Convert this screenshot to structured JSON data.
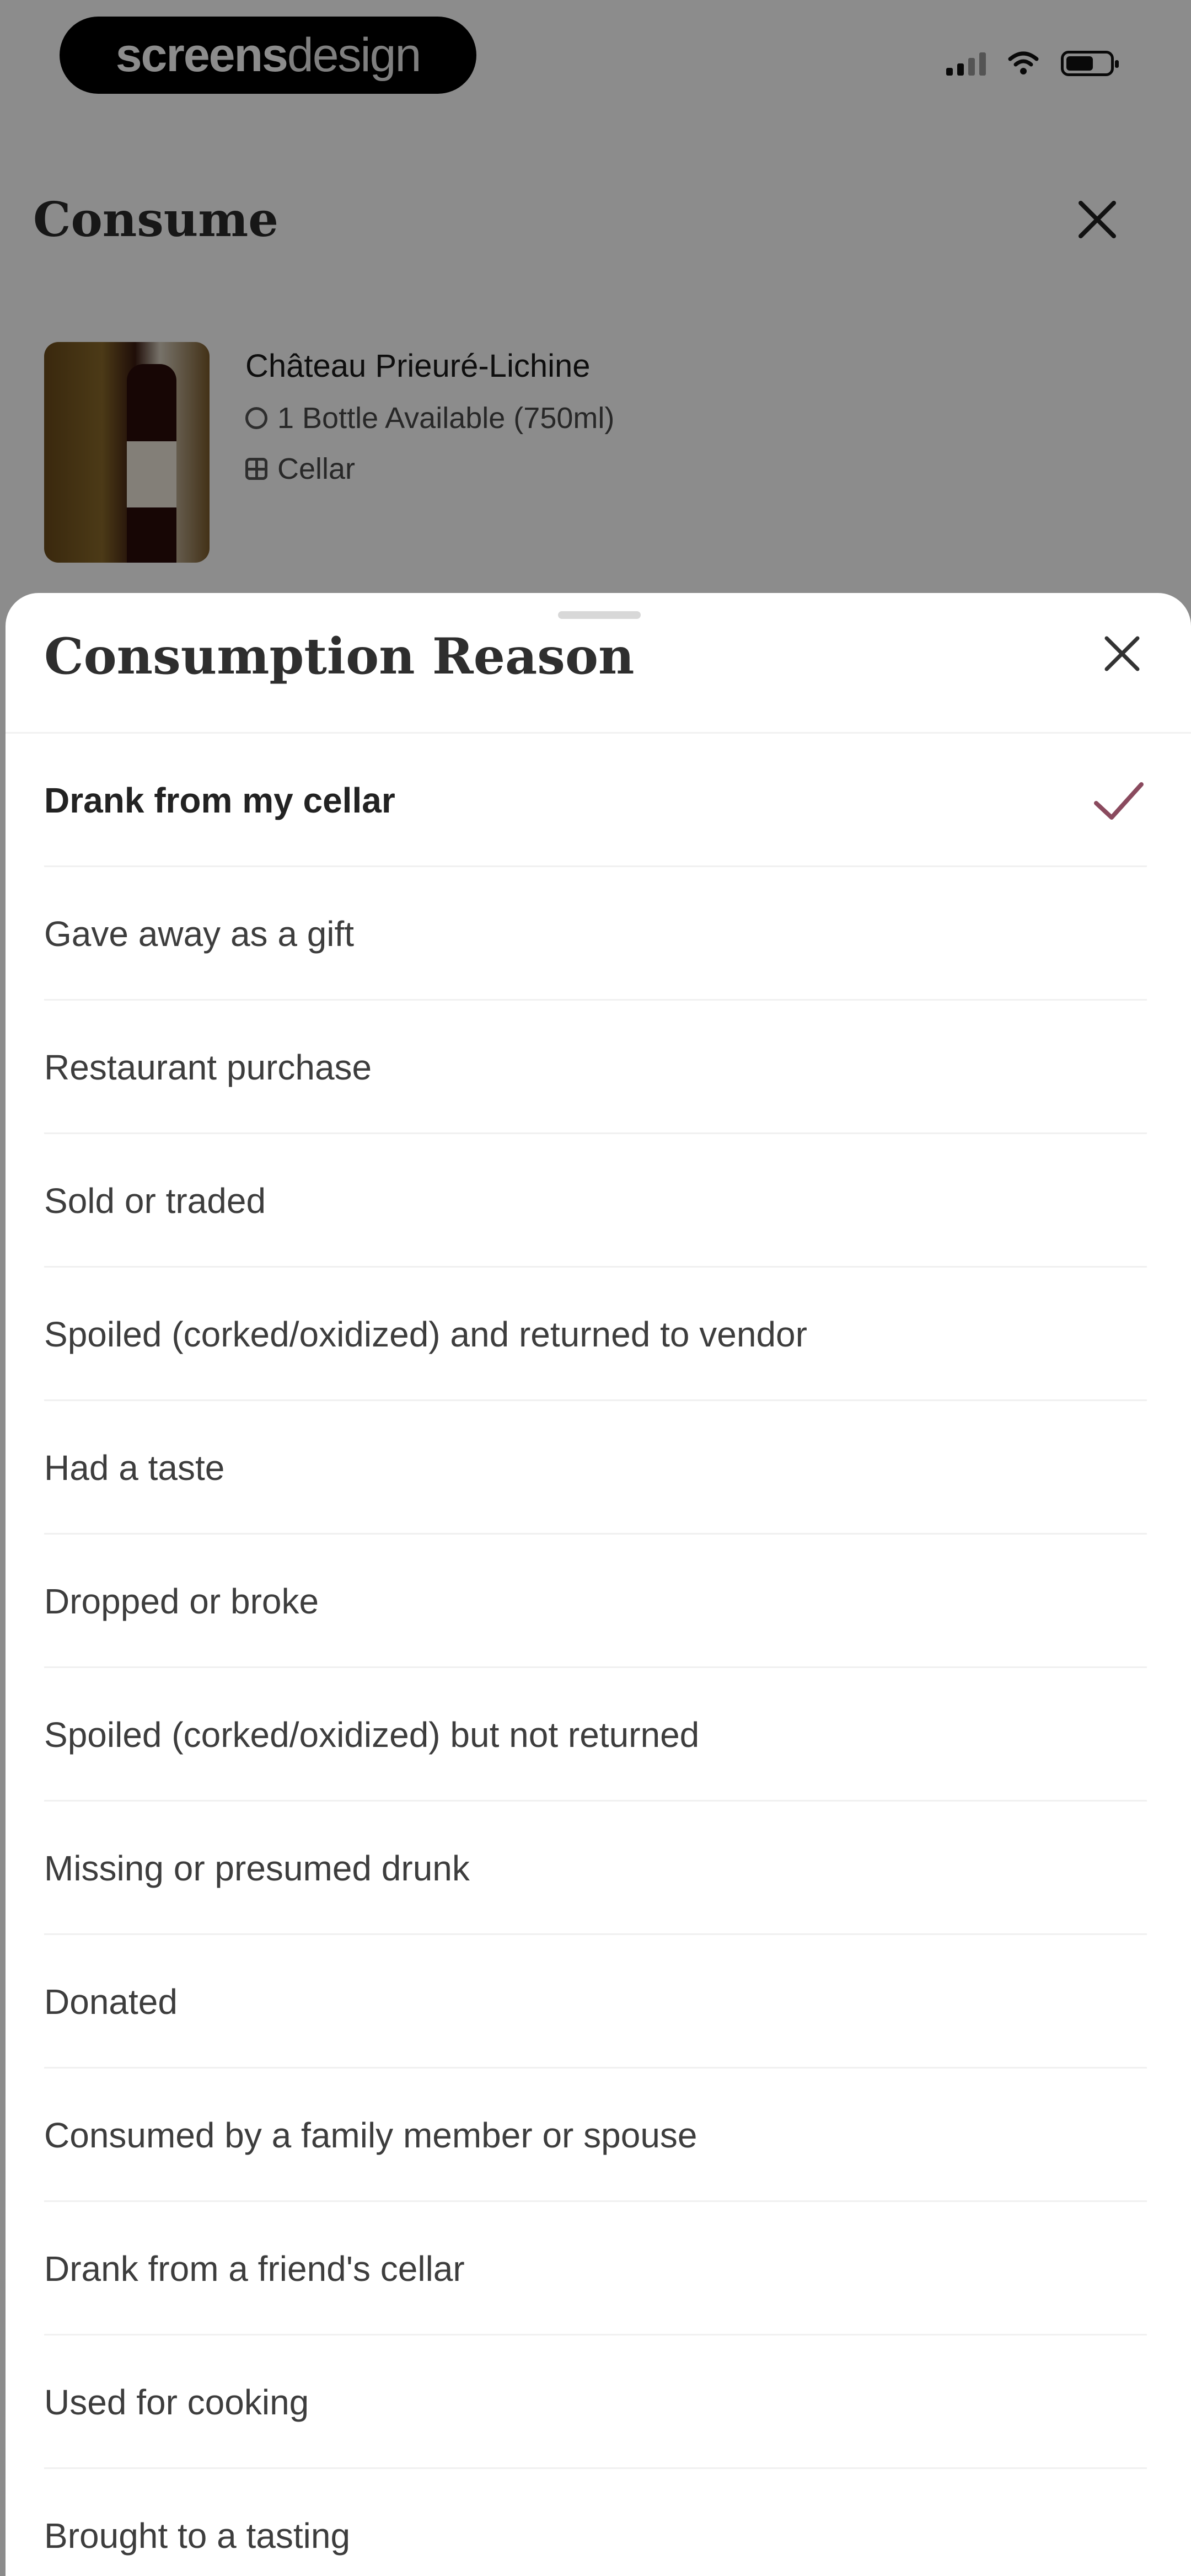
{
  "status_bar": {
    "brand_part1": "screens",
    "brand_part2": "design"
  },
  "page": {
    "title": "Consume",
    "close_icon": "close-icon"
  },
  "wine": {
    "name": "Château Prieuré-Lichine",
    "availability": "1 Bottle Available (750ml)",
    "location": "Cellar"
  },
  "sheet": {
    "title": "Consumption Reason",
    "close_icon": "close-icon",
    "selected_index": 0,
    "accent_color": "#8a4a5e",
    "options": [
      "Drank from my cellar",
      "Gave away as a gift",
      "Restaurant purchase",
      "Sold or traded",
      "Spoiled (corked/oxidized) and returned to vendor",
      "Had a taste",
      "Dropped or broke",
      "Spoiled (corked/oxidized) but not returned",
      "Missing or presumed drunk",
      "Donated",
      "Consumed by a family member or spouse",
      "Drank from a friend's cellar",
      "Used for cooking",
      "Brought to a tasting"
    ]
  }
}
